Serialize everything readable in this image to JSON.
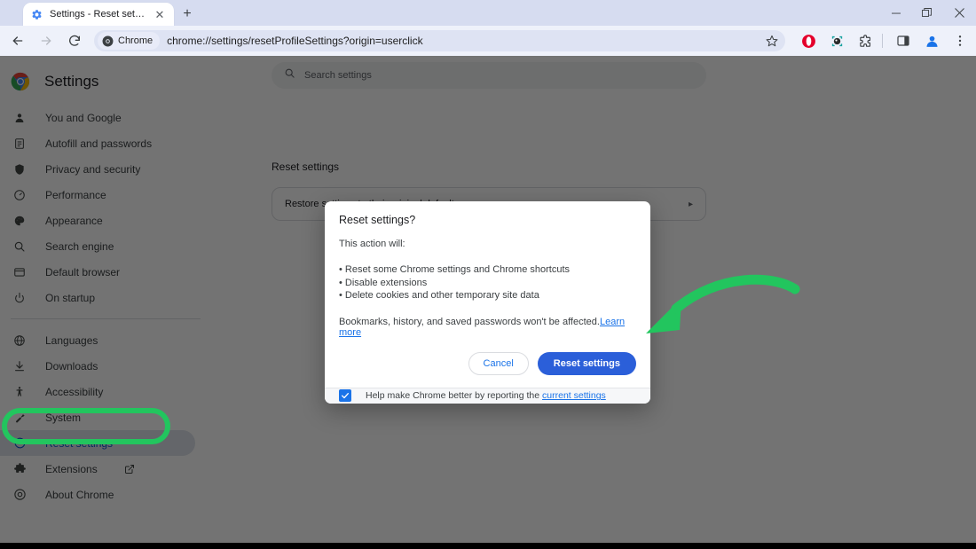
{
  "window": {
    "controls": [
      {
        "name": "minimize",
        "glyph": "—"
      },
      {
        "name": "maximize",
        "glyph": "❐"
      },
      {
        "name": "close",
        "glyph": "✕"
      }
    ]
  },
  "tabstrip": {
    "tab_search_icon": "chevron-down-icon",
    "tab": {
      "favicon": "settings-gear-icon",
      "title": "Settings - Reset settings",
      "close_glyph": "✕"
    },
    "new_tab_glyph": "+"
  },
  "toolbar": {
    "back_glyph": "←",
    "forward_glyph": "→",
    "reload_glyph": "↻",
    "chip_label": "Chrome",
    "url": "chrome://settings/resetProfileSettings?origin=userclick",
    "bookmark_glyph": "☆",
    "right_icons": [
      {
        "name": "opera-extension-icon"
      },
      {
        "name": "dark-extension-icon"
      },
      {
        "name": "extensions-puzzle-icon"
      },
      {
        "name": "side-panel-icon"
      },
      {
        "name": "profile-avatar-icon"
      },
      {
        "name": "more-menu-icon",
        "glyph": "⋮"
      }
    ]
  },
  "settings": {
    "brand_title": "Settings",
    "search": {
      "placeholder": "Search settings",
      "icon": "search-icon"
    },
    "section_title": "Reset settings",
    "card": {
      "label": "Restore settings to their original defaults",
      "arrow": "▸"
    },
    "nav_groups": [
      [
        {
          "label": "You and Google",
          "icon": "person-icon"
        },
        {
          "label": "Autofill and passwords",
          "icon": "clipboard-icon"
        },
        {
          "label": "Privacy and security",
          "icon": "shield-icon"
        },
        {
          "label": "Performance",
          "icon": "speedometer-icon"
        },
        {
          "label": "Appearance",
          "icon": "palette-icon"
        },
        {
          "label": "Search engine",
          "icon": "search-icon"
        },
        {
          "label": "Default browser",
          "icon": "browser-window-icon"
        },
        {
          "label": "On startup",
          "icon": "power-icon"
        }
      ],
      [
        {
          "label": "Languages",
          "icon": "globe-icon"
        },
        {
          "label": "Downloads",
          "icon": "download-icon"
        },
        {
          "label": "Accessibility",
          "icon": "accessibility-icon"
        },
        {
          "label": "System",
          "icon": "wrench-icon"
        },
        {
          "label": "Reset settings",
          "icon": "restore-clock-icon",
          "selected": true
        },
        {
          "label": "Extensions",
          "icon": "puzzle-icon",
          "external": true
        },
        {
          "label": "About Chrome",
          "icon": "chrome-icon"
        }
      ]
    ]
  },
  "dialog": {
    "title": "Reset settings?",
    "lead": "This action will:",
    "bullets": [
      "• Reset some Chrome settings and Chrome shortcuts",
      "• Disable extensions",
      "• Delete cookies and other temporary site data"
    ],
    "note_text": "Bookmarks, history, and saved passwords won't be affected.",
    "note_link": "Learn more",
    "cancel_label": "Cancel",
    "confirm_label": "Reset settings",
    "footer": {
      "checked": true,
      "check_glyph": "✓",
      "text": "Help make Chrome better by reporting the ",
      "link": "current settings"
    }
  },
  "annotations": {
    "highlight_color": "#22c55e",
    "ellipse_target": "Reset settings",
    "arrow_target": "Reset settings button"
  },
  "colors": {
    "accent_blue": "#1a73e8",
    "primary_button": "#2b5fd9",
    "annotation_green": "#22c55e",
    "tabstrip": "#d6dcf0",
    "toolbar": "#eef1fa"
  }
}
